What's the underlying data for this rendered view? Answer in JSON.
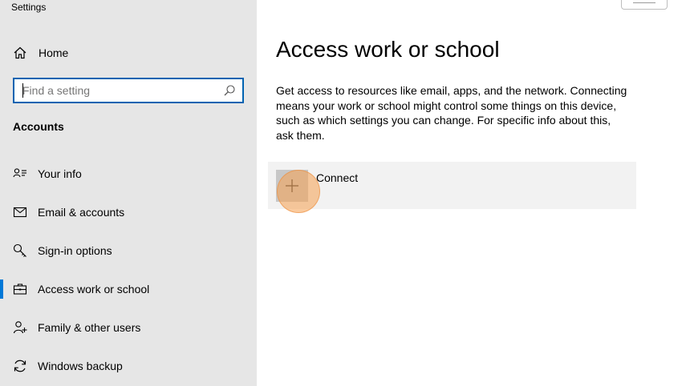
{
  "window": {
    "title": "Settings"
  },
  "sidebar": {
    "home_label": "Home",
    "search": {
      "placeholder": "Find a setting",
      "value": ""
    },
    "section_heading": "Accounts",
    "items": [
      {
        "label": "Your info",
        "icon": "person-card-icon",
        "active": false
      },
      {
        "label": "Email & accounts",
        "icon": "mail-icon",
        "active": false
      },
      {
        "label": "Sign-in options",
        "icon": "key-icon",
        "active": false
      },
      {
        "label": "Access work or school",
        "icon": "briefcase-icon",
        "active": true
      },
      {
        "label": "Family & other users",
        "icon": "person-add-icon",
        "active": false
      },
      {
        "label": "Windows backup",
        "icon": "sync-icon",
        "active": false
      }
    ]
  },
  "main": {
    "title": "Access work or school",
    "description": "Get access to resources like email, apps, and the network. Connecting means your work or school might control some things on this device, such as which settings you can change. For specific info about this, ask them.",
    "connect_label": "Connect"
  },
  "colors": {
    "sidebar_bg": "#e6e6e6",
    "accent": "#0078d7",
    "tile_bg": "#f2f2f2",
    "click_highlight": "#f6a050"
  }
}
